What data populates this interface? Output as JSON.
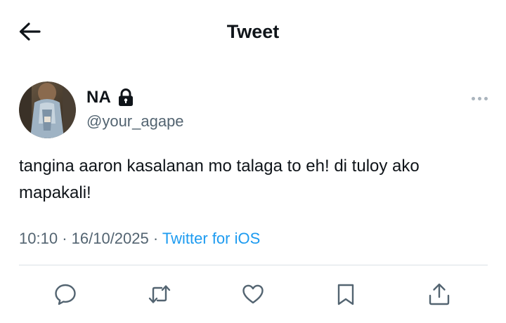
{
  "header": {
    "title": "Tweet",
    "back_icon": "back-arrow-icon"
  },
  "author": {
    "display_name": "NA",
    "handle": "@your_agape",
    "protected_icon": "lock-icon",
    "avatar": "avatar-photo"
  },
  "tweet": {
    "text": "tangina aaron kasalanan mo talaga to eh! di tuloy ako mapakali!",
    "time": "10:10",
    "date": "16/10/2025",
    "source": "Twitter for iOS",
    "separator": "·"
  },
  "actions": [
    {
      "name": "reply",
      "icon": "reply-icon"
    },
    {
      "name": "retweet",
      "icon": "retweet-icon"
    },
    {
      "name": "like",
      "icon": "heart-icon"
    },
    {
      "name": "bookmark",
      "icon": "bookmark-icon"
    },
    {
      "name": "share",
      "icon": "share-icon"
    }
  ],
  "colors": {
    "text": "#0f1419",
    "secondary": "#536471",
    "link": "#1d9bf0",
    "divider": "#dbe1e5",
    "background": "#ffffff"
  }
}
